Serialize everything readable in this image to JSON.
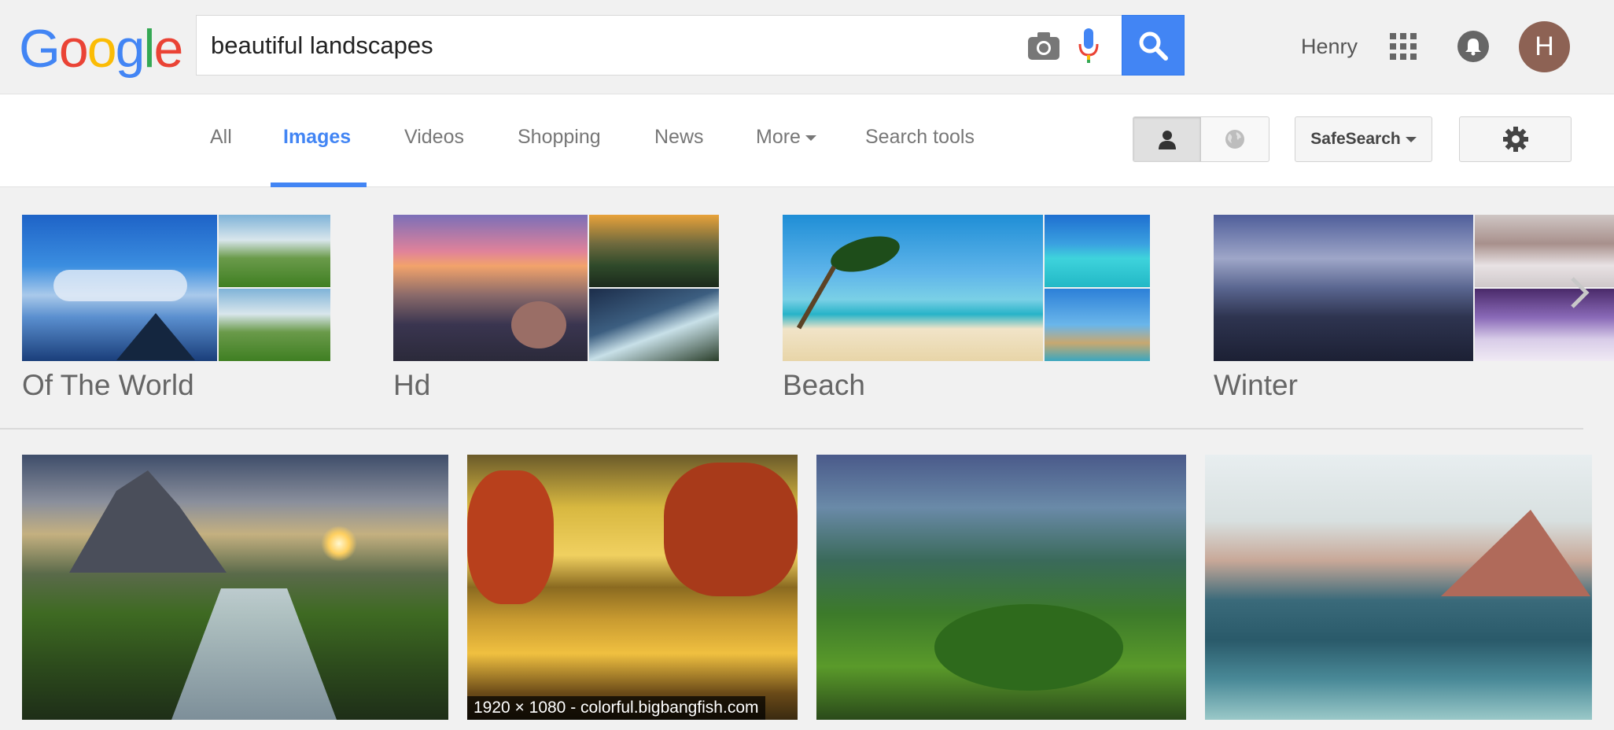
{
  "header": {
    "logo_letters": [
      "G",
      "o",
      "o",
      "g",
      "l",
      "e"
    ],
    "logo_colors": [
      "#4285f4",
      "#ea4335",
      "#fbbc05",
      "#4285f4",
      "#34a853",
      "#ea4335"
    ],
    "search_value": "beautiful landscapes",
    "user_name": "Henry",
    "avatar_initial": "H",
    "accent": "#4285f4"
  },
  "nav": {
    "tabs": [
      {
        "label": "All"
      },
      {
        "label": "Images"
      },
      {
        "label": "Videos"
      },
      {
        "label": "Shopping"
      },
      {
        "label": "News"
      },
      {
        "label": "More"
      },
      {
        "label": "Search tools"
      }
    ],
    "active_tab": "Images",
    "safesearch_label": "SafeSearch"
  },
  "related": [
    {
      "label": "Of The World"
    },
    {
      "label": "Hd"
    },
    {
      "label": "Beach"
    },
    {
      "label": "Winter"
    }
  ],
  "results": [
    {
      "caption": ""
    },
    {
      "caption": "1920 × 1080 - colorful.bigbangfish.com"
    },
    {
      "caption": ""
    },
    {
      "caption": ""
    }
  ],
  "icons": [
    "camera-icon",
    "microphone-icon",
    "search-icon",
    "apps-grid-icon",
    "notifications-bell-icon",
    "person-icon",
    "globe-icon",
    "gear-icon",
    "chevron-right-icon"
  ]
}
